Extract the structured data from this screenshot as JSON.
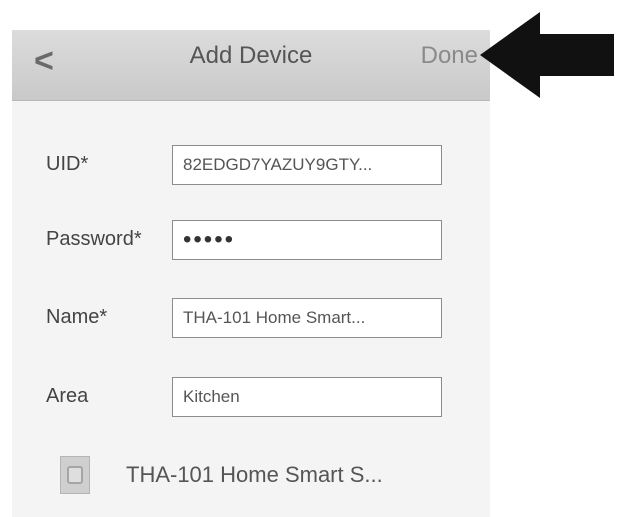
{
  "navbar": {
    "back_label": "<",
    "title": "Add Device",
    "done_label": "Done"
  },
  "form": {
    "uid": {
      "label": "UID*",
      "value": "82EDGD7YAZUY9GTY..."
    },
    "password": {
      "label": "Password*",
      "value": "•••••"
    },
    "name": {
      "label": "Name*",
      "value": "THA-101 Home Smart..."
    },
    "area": {
      "label": "Area",
      "value": "Kitchen"
    }
  },
  "device": {
    "name": "THA-101 Home Smart S...",
    "icon": "smart-plug-icon"
  },
  "annotation": {
    "icon": "pointer-arrow-icon",
    "color": "#111111"
  }
}
